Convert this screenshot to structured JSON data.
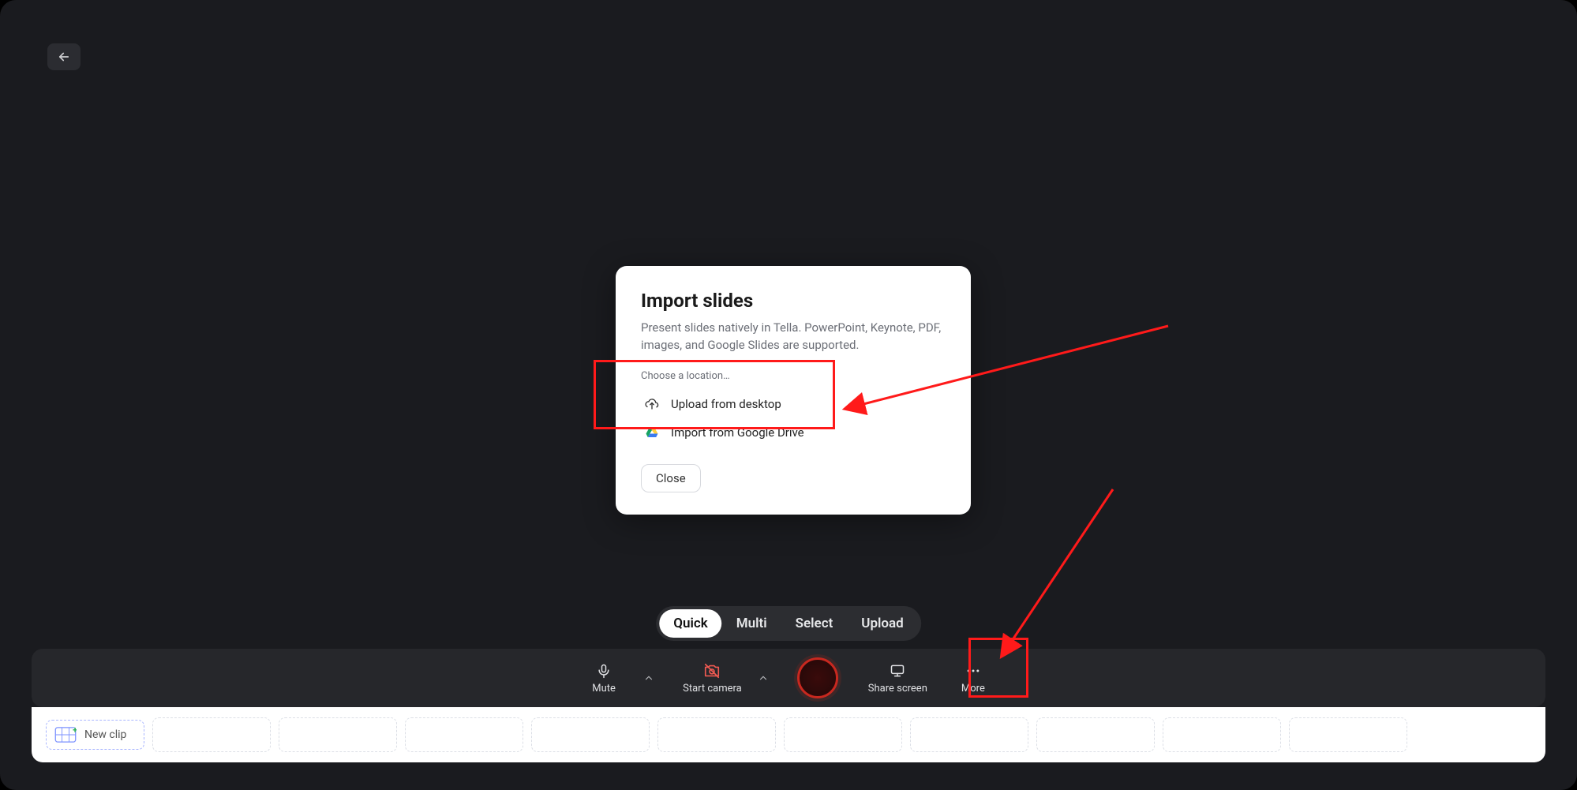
{
  "modal": {
    "title": "Import slides",
    "description": "Present slides natively in Tella. PowerPoint, Keynote, PDF, images, and Google Slides are supported.",
    "choose_label": "Choose a location…",
    "upload_desktop": "Upload from desktop",
    "import_gdrive": "Import from Google Drive",
    "close": "Close"
  },
  "modes": {
    "quick": "Quick",
    "multi": "Multi",
    "select": "Select",
    "upload": "Upload"
  },
  "toolbar": {
    "mute": "Mute",
    "start_camera": "Start camera",
    "share_screen": "Share screen",
    "more": "More"
  },
  "clips": {
    "new_clip": "New clip"
  }
}
